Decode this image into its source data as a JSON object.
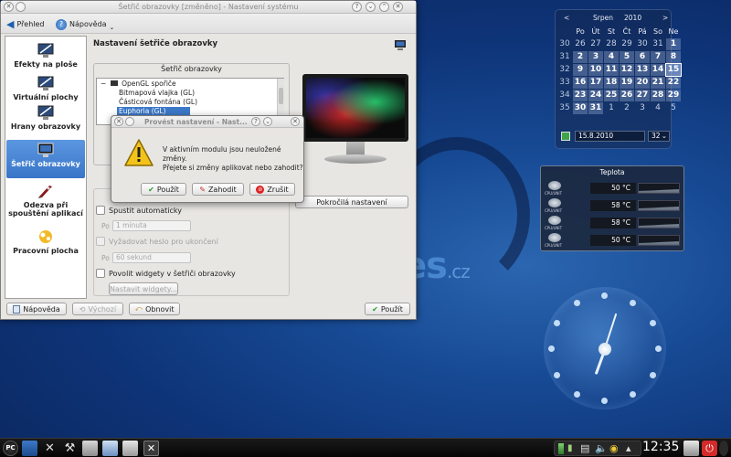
{
  "window": {
    "title": "Šetřič obrazovky [změněno] - Nastavení systému",
    "toolbar": {
      "overview": "Přehled",
      "help": "Nápověda"
    },
    "sidebar": [
      {
        "label": "Efekty na ploše",
        "icon": "desktop-effects-icon"
      },
      {
        "label": "Virtuální plochy",
        "icon": "virtual-desktops-icon"
      },
      {
        "label": "Hrany obrazovky",
        "icon": "screen-edges-icon"
      },
      {
        "label": "Šetřič obrazovky",
        "icon": "monitor-icon",
        "selected": true
      },
      {
        "label": "Odezva při spouštění aplikací",
        "icon": "rocket-icon"
      },
      {
        "label": "Pracovní plocha",
        "icon": "workspace-icon"
      }
    ],
    "content_title": "Nastavení šetřiče obrazovky",
    "group_title": "Šetřič obrazovky",
    "tree": [
      {
        "label": "OpenGL spořiče",
        "expanded": true
      },
      {
        "label": "Bitmapová vlajka (GL)"
      },
      {
        "label": "Částicová fontána (GL)"
      },
      {
        "label": "Euphoria (GL)",
        "selected": true
      }
    ],
    "advanced_button": "Pokročilá nastavení",
    "options": {
      "start_auto": "Spustit automaticky",
      "after_label": "Po",
      "after_value": "1 minuta",
      "require_password": "Vyžadovat heslo pro ukončení",
      "after_label2": "Po",
      "after_value2": "60 sekund",
      "allow_widgets": "Povolit widgety v šetřiči obrazovky",
      "setup_widgets": "Nastavit widgety..."
    },
    "bottom": {
      "help": "Nápověda",
      "defaults": "Výchozí",
      "reset": "Obnovit",
      "apply": "Použít"
    }
  },
  "dialog": {
    "title": "Provést nastavení - Nast...",
    "message_line1": "V aktivním modulu jsou neuložené změny.",
    "message_line2": "Přejete si změny aplikovat nebo zahodit?",
    "buttons": {
      "apply": "Použít",
      "discard": "Zahodit",
      "cancel": "Zrušit"
    }
  },
  "desktop": {
    "logo": "es",
    "logo_suffix": ".cz"
  },
  "calendar": {
    "month": "Srpen",
    "year": "2010",
    "weekdays": [
      "Po",
      "Út",
      "St",
      "Čt",
      "Pá",
      "So",
      "Ne"
    ],
    "weeks": [
      {
        "week": "30",
        "days": [
          "26",
          "27",
          "28",
          "29",
          "30",
          "31",
          "1"
        ]
      },
      {
        "week": "31",
        "days": [
          "2",
          "3",
          "4",
          "5",
          "6",
          "7",
          "8"
        ]
      },
      {
        "week": "32",
        "days": [
          "9",
          "10",
          "11",
          "12",
          "13",
          "14",
          "15"
        ]
      },
      {
        "week": "33",
        "days": [
          "16",
          "17",
          "18",
          "19",
          "20",
          "21",
          "22"
        ]
      },
      {
        "week": "34",
        "days": [
          "23",
          "24",
          "25",
          "26",
          "27",
          "28",
          "29"
        ]
      },
      {
        "week": "35",
        "days": [
          "30",
          "31",
          "1",
          "2",
          "3",
          "4",
          "5"
        ]
      }
    ],
    "date_value": "15.8.2010",
    "week_value": "32"
  },
  "temperature": {
    "title": "Teplota",
    "sensors": [
      {
        "name": "CPU/UNIT",
        "value": "50 °C"
      },
      {
        "name": "CPU/UNIT",
        "value": "58 °C"
      },
      {
        "name": "CPU/UNIT",
        "value": "58 °C"
      },
      {
        "name": "CPU/UNIT",
        "value": "50 °C"
      }
    ]
  },
  "taskbar": {
    "time": "12:35"
  },
  "colors": {
    "accent": "#3c78c8",
    "taskbar": "#0a0a0a",
    "desktop": "#174a94"
  }
}
